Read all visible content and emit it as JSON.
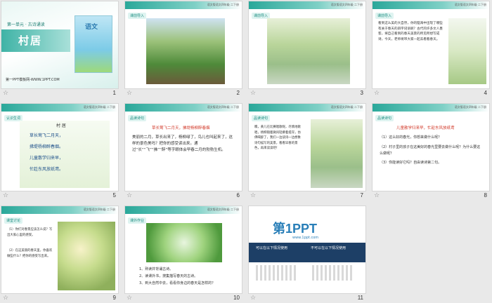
{
  "slides": [
    {
      "number": "1",
      "subtitle": "第一单元 · 古诗诵读",
      "title": "村居",
      "book_label": "语文",
      "footer": "第一PPT模板网-WWW.1PPT.COM"
    },
    {
      "number": "2",
      "section": "课前导入"
    },
    {
      "number": "3",
      "section": "课前导入"
    },
    {
      "number": "4",
      "section": "课前导入",
      "text": "看到这么美的大自然，你的脑海中出现了哪些有关于春天的四字词语呢？古代的许多文人墨客，将自己看到的春天美景的所见所想写成诗，今天，老师将带大家一起去看看春天。"
    },
    {
      "number": "5",
      "section": "认识生词",
      "poem_title": "村 居",
      "poem_lines": [
        "草长莺飞二月天，",
        "拂堤杨柳醉春烟。",
        "儿童散学归来早，",
        "忙趁东风放纸鸢。"
      ]
    },
    {
      "number": "6",
      "section": "品读诗句",
      "highlight": "草长莺飞二月天，拂堤杨柳醉春烟",
      "text": "美丽的二月，草长出来了，杨柳绿了，鸟儿也叫起来了，这样的景色美吗？把你的感受读出来。通过“长”“飞”“拂”“醉”等字眼体会早春二月的勃勃生机。"
    },
    {
      "number": "7",
      "section": "品读诗句",
      "text": "瞧，黄儿在比赛唱歌呢，尽情地歌唱，杨柳随着微风轻拂着堤岸，仿佛喝醉了，我们一边读诗一边想象诗句描写的美景，看看早春的景色，再来读读吧！"
    },
    {
      "number": "8",
      "section": "品读诗句",
      "highlight": "儿童散学归来早，忙趁东风放纸鸢",
      "questions": [
        "（1）这么好的春光，你想来做什么呢？",
        "（2）村子里的孩子在这美好的春光里要去做什么呢？为什么要这么做呢？",
        "（3）你能读好它吗？自由读诗第二句。"
      ]
    },
    {
      "number": "9",
      "section": "课堂讨论",
      "questions": [
        "（1）你们对春景应该怎么说？写出大家心里的感受。",
        "（2）在这美丽的春天里，你喜欢做些什么？把你的感受写出来。"
      ]
    },
    {
      "number": "10",
      "section": "课外作业",
      "items": [
        "1、熟读并背诵古诗。",
        "2、读课外书，搜集描写春天的古诗。",
        "3、到大自然中去，看看你身边的春天是怎样的？"
      ]
    },
    {
      "number": "11",
      "logo_text": "第1PPT",
      "tagline": "www.1ppt.com",
      "left_notice": "可以在以下情况使用",
      "right_notice": "不可以在以下情况使用"
    }
  ],
  "header_text": "语文版语文四年级 二下册"
}
